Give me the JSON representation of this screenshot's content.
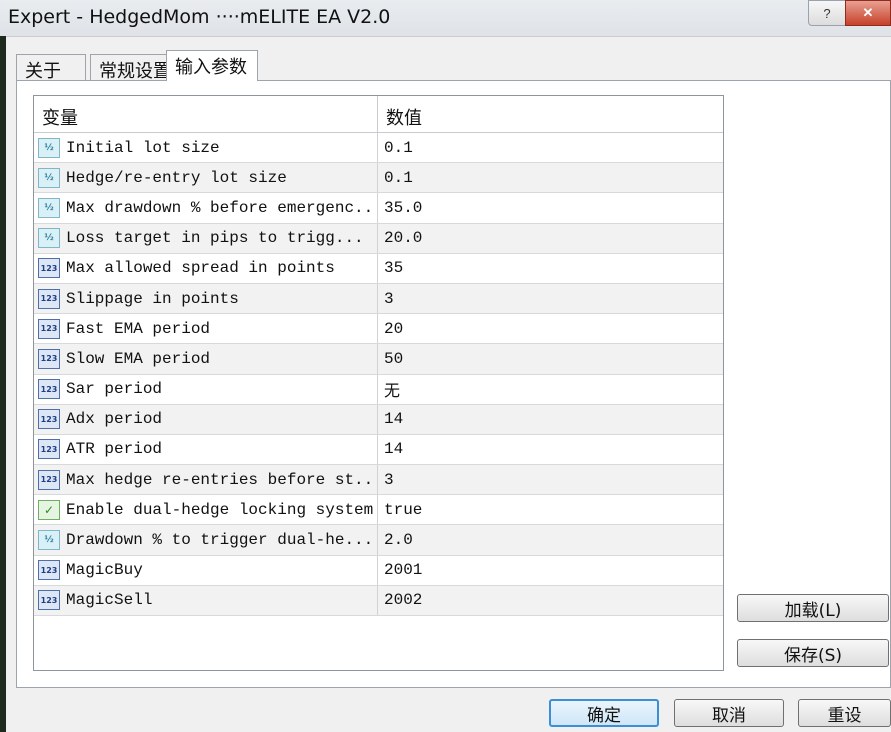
{
  "window": {
    "title": "Expert - HedgedMom  ····mELITE EA V2.0",
    "help_label": "?",
    "close_label": "✕"
  },
  "tabs": [
    {
      "label": "关于"
    },
    {
      "label": "常规设置"
    },
    {
      "label": "输入参数"
    }
  ],
  "grid": {
    "header_name": "变量",
    "header_value": "数值",
    "rows": [
      {
        "icon": "frac",
        "name": "Initial lot size",
        "value": "0.1"
      },
      {
        "icon": "frac",
        "name": "Hedge/re-entry lot size",
        "value": "0.1"
      },
      {
        "icon": "frac",
        "name": "Max drawdown % before emergenc...",
        "value": "35.0"
      },
      {
        "icon": "frac",
        "name": "Loss target in pips to trigg...",
        "value": "20.0"
      },
      {
        "icon": "int",
        "name": "Max allowed spread in points",
        "value": "35"
      },
      {
        "icon": "int",
        "name": "Slippage in points",
        "value": "3"
      },
      {
        "icon": "int",
        "name": "Fast EMA period",
        "value": "20"
      },
      {
        "icon": "int",
        "name": "Slow EMA period",
        "value": "50"
      },
      {
        "icon": "int",
        "name": "Sar period",
        "value": "无"
      },
      {
        "icon": "int",
        "name": "Adx period",
        "value": "14"
      },
      {
        "icon": "int",
        "name": "ATR period",
        "value": "14"
      },
      {
        "icon": "int",
        "name": "Max hedge re-entries before st...",
        "value": "3"
      },
      {
        "icon": "bool",
        "name": "Enable dual-hedge locking system",
        "value": "true"
      },
      {
        "icon": "frac",
        "name": "Drawdown % to trigger dual-he...",
        "value": "2.0"
      },
      {
        "icon": "int",
        "name": "MagicBuy",
        "value": "2001"
      },
      {
        "icon": "int",
        "name": "MagicSell",
        "value": "2002"
      }
    ]
  },
  "icons": {
    "frac": "½",
    "int": "123",
    "bool": "✓"
  },
  "buttons": {
    "load": "加载(L)",
    "save": "保存(S)",
    "ok": "确定",
    "cancel": "取消",
    "reset": "重设"
  }
}
